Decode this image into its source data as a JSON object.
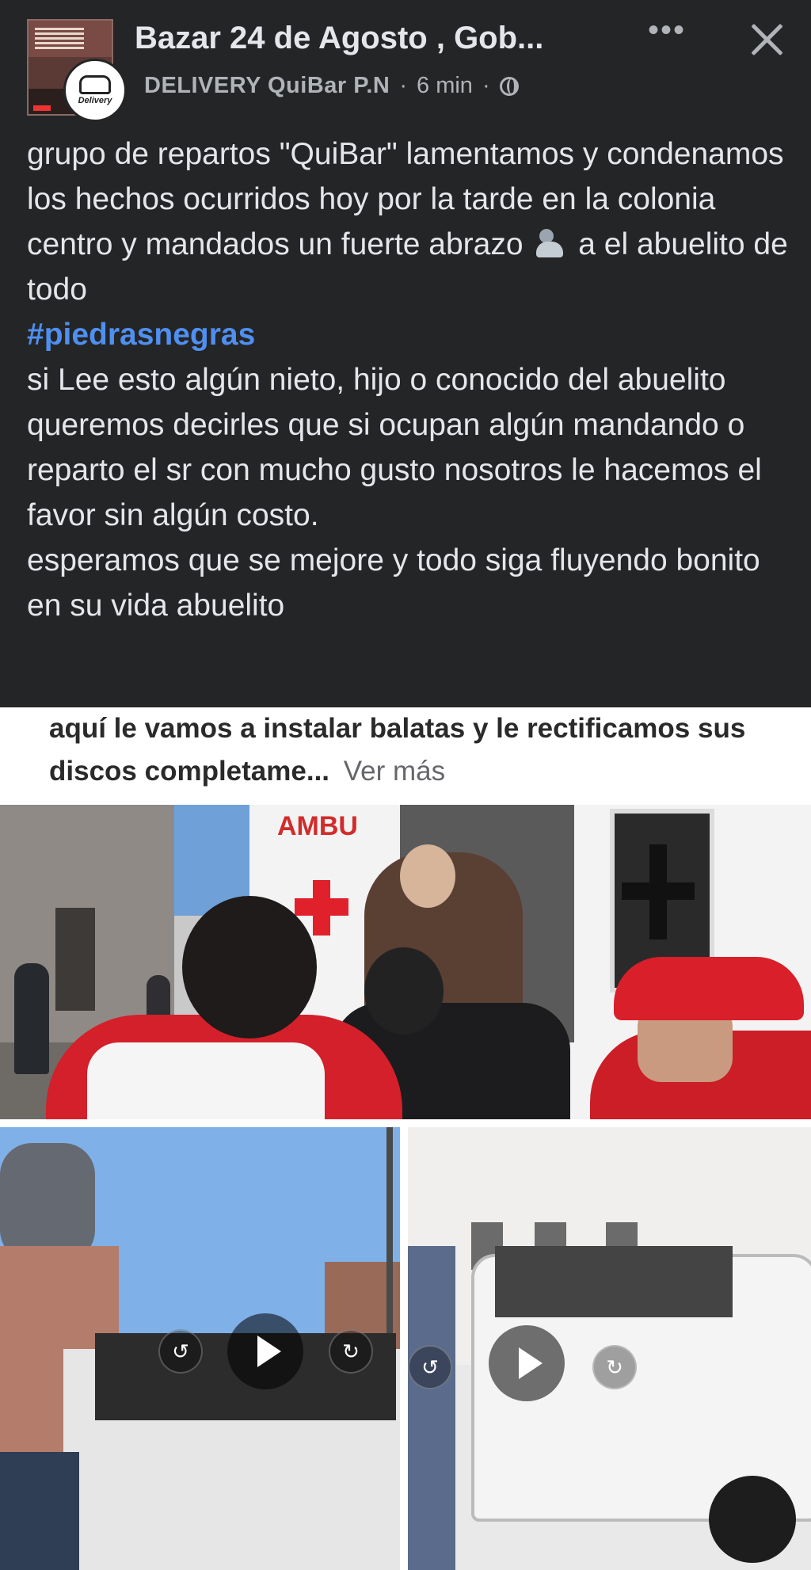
{
  "header": {
    "group_name": "Bazar 24 de Agosto , Gob...",
    "author": "DELIVERY  QuiBar P.N",
    "separator": "·",
    "time": "6 min",
    "separator2": "·",
    "privacy_icon": "globe-icon",
    "more_icon": "more-icon",
    "close_icon": "close-icon"
  },
  "post": {
    "line1_before": "grupo de repartos \"QuiBar\" lamentamos y condenamos los hechos ocurridos hoy por la tarde en la colonia centro y mandados un fuerte abrazo",
    "hug_icon": "people-hugging-icon",
    "line1_after": "a el abuelito de todo",
    "hashtag": "#piedrasnegras",
    "paragraph2": "si Lee esto algún nieto, hijo o conocido del abuelito queremos decirles que si ocupan algún mandando o reparto el sr con mucho gusto nosotros le hacemos el favor sin algún costo.",
    "paragraph3": "esperamos que se mejore y todo siga fluyendo bonito en su vida abuelito"
  },
  "shared": {
    "text": "aquí le vamos a instalar balatas y le rectificamos sus discos completame...",
    "see_more": "Ver más",
    "ambulance_label": "AMBU"
  },
  "colors": {
    "background": "#242526",
    "text": "#e4e6eb",
    "secondary": "#b0b3b8",
    "hashtag": "#4f8ff0"
  }
}
